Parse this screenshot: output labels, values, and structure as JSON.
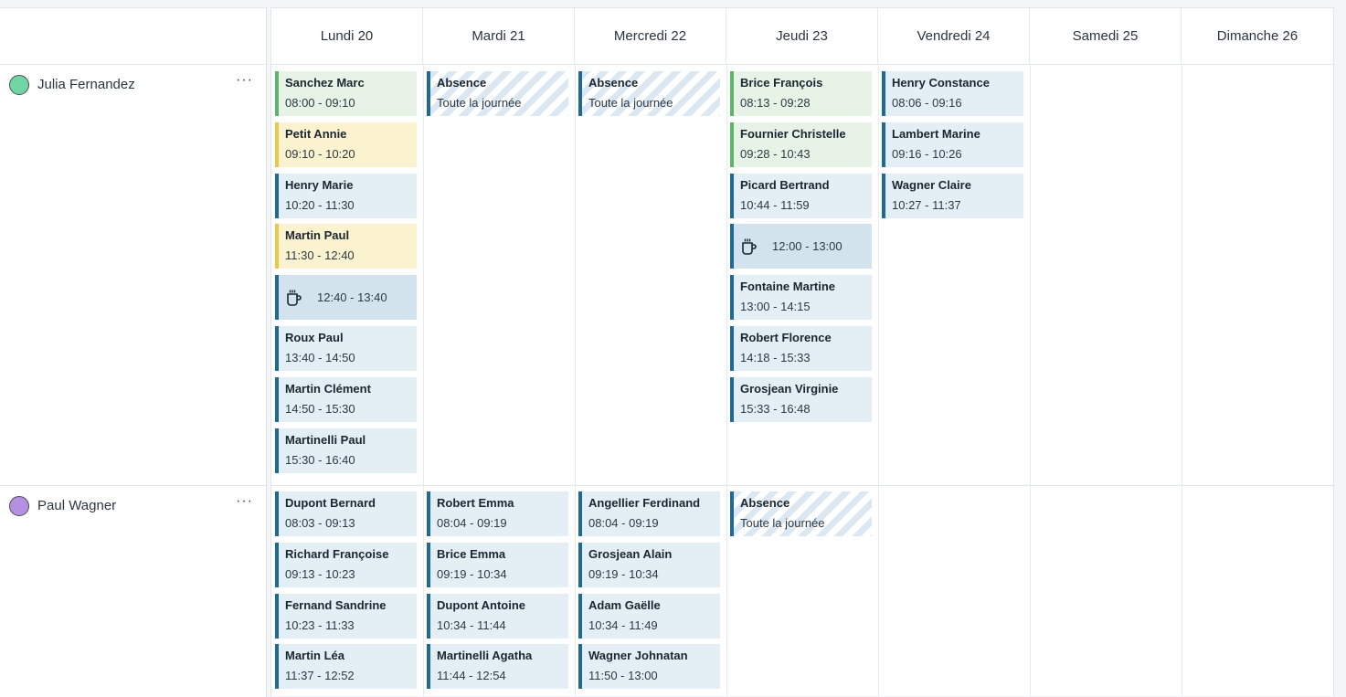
{
  "colors": {
    "julia_avatar": "#6fd6a4",
    "paul_avatar": "#b58fe0",
    "event_blue": "#e3eef5",
    "event_green": "#e6f3e6",
    "event_yellow": "#fbf2cf",
    "accent": "#1d6a96"
  },
  "days": [
    {
      "label": "Lundi 20"
    },
    {
      "label": "Mardi 21"
    },
    {
      "label": "Mercredi 22"
    },
    {
      "label": "Jeudi 23"
    },
    {
      "label": "Vendredi 24"
    },
    {
      "label": "Samedi 25"
    },
    {
      "label": "Dimanche 26"
    }
  ],
  "people": [
    {
      "name": "Julia Fernandez",
      "menu": "···"
    },
    {
      "name": "Paul Wagner",
      "menu": "···"
    }
  ],
  "events": [
    {
      "person": 0,
      "day": 0,
      "slot": 0,
      "kind": "green",
      "title": "Sanchez Marc",
      "time": "08:00 - 09:10"
    },
    {
      "person": 0,
      "day": 0,
      "slot": 1,
      "kind": "yellow",
      "title": "Petit Annie",
      "time": "09:10 - 10:20"
    },
    {
      "person": 0,
      "day": 0,
      "slot": 2,
      "kind": "blue",
      "title": "Henry Marie",
      "time": "10:20 - 11:30"
    },
    {
      "person": 0,
      "day": 0,
      "slot": 3,
      "kind": "yellow",
      "title": "Martin Paul",
      "time": "11:30 - 12:40"
    },
    {
      "person": 0,
      "day": 0,
      "slot": 4,
      "kind": "pause",
      "icon": "coffee-cup-icon",
      "time": "12:40 - 13:40"
    },
    {
      "person": 0,
      "day": 0,
      "slot": 5,
      "kind": "blue",
      "title": "Roux Paul",
      "time": "13:40 - 14:50"
    },
    {
      "person": 0,
      "day": 0,
      "slot": 6,
      "kind": "blue",
      "title": "Martin Clément",
      "time": "14:50 - 15:30"
    },
    {
      "person": 0,
      "day": 0,
      "slot": 7,
      "kind": "blue",
      "title": "Martinelli Paul",
      "time": "15:30 - 16:40"
    },
    {
      "person": 0,
      "day": 1,
      "slot": 0,
      "kind": "absence",
      "title": "Absence",
      "time": "Toute la journée"
    },
    {
      "person": 0,
      "day": 2,
      "slot": 0,
      "kind": "absence",
      "title": "Absence",
      "time": "Toute la journée"
    },
    {
      "person": 0,
      "day": 3,
      "slot": 0,
      "kind": "green",
      "title": "Brice François",
      "time": "08:13 - 09:28"
    },
    {
      "person": 0,
      "day": 3,
      "slot": 1,
      "kind": "green",
      "title": "Fournier Christelle",
      "time": "09:28 - 10:43"
    },
    {
      "person": 0,
      "day": 3,
      "slot": 2,
      "kind": "blue",
      "title": "Picard Bertrand",
      "time": "10:44 - 11:59"
    },
    {
      "person": 0,
      "day": 3,
      "slot": 3,
      "kind": "pause",
      "icon": "coffee-cup-icon",
      "time": "12:00 - 13:00"
    },
    {
      "person": 0,
      "day": 3,
      "slot": 4,
      "kind": "blue",
      "title": "Fontaine Martine",
      "time": "13:00 - 14:15"
    },
    {
      "person": 0,
      "day": 3,
      "slot": 5,
      "kind": "blue",
      "title": "Robert Florence",
      "time": "14:18 - 15:33"
    },
    {
      "person": 0,
      "day": 3,
      "slot": 6,
      "kind": "blue",
      "title": "Grosjean Virginie",
      "time": "15:33 - 16:48"
    },
    {
      "person": 0,
      "day": 4,
      "slot": 0,
      "kind": "blue",
      "title": "Henry Constance",
      "time": "08:06 - 09:16"
    },
    {
      "person": 0,
      "day": 4,
      "slot": 1,
      "kind": "blue",
      "title": "Lambert Marine",
      "time": "09:16 - 10:26"
    },
    {
      "person": 0,
      "day": 4,
      "slot": 2,
      "kind": "blue",
      "title": "Wagner Claire",
      "time": "10:27 - 11:37"
    },
    {
      "person": 1,
      "day": 0,
      "slot": 0,
      "kind": "blue",
      "title": "Dupont Bernard",
      "time": "08:03 - 09:13"
    },
    {
      "person": 1,
      "day": 0,
      "slot": 1,
      "kind": "blue",
      "title": "Richard Françoise",
      "time": "09:13 - 10:23"
    },
    {
      "person": 1,
      "day": 0,
      "slot": 2,
      "kind": "blue",
      "title": "Fernand Sandrine",
      "time": "10:23 - 11:33"
    },
    {
      "person": 1,
      "day": 0,
      "slot": 3,
      "kind": "blue",
      "title": "Martin Léa",
      "time": "11:37 - 12:52"
    },
    {
      "person": 1,
      "day": 1,
      "slot": 0,
      "kind": "blue",
      "title": "Robert Emma",
      "time": "08:04 - 09:19"
    },
    {
      "person": 1,
      "day": 1,
      "slot": 1,
      "kind": "blue",
      "title": "Brice Emma",
      "time": "09:19 - 10:34"
    },
    {
      "person": 1,
      "day": 1,
      "slot": 2,
      "kind": "blue",
      "title": "Dupont Antoine",
      "time": "10:34 - 11:44"
    },
    {
      "person": 1,
      "day": 1,
      "slot": 3,
      "kind": "blue",
      "title": "Martinelli Agatha",
      "time": "11:44 - 12:54"
    },
    {
      "person": 1,
      "day": 2,
      "slot": 0,
      "kind": "blue",
      "title": "Angellier Ferdinand",
      "time": "08:04 - 09:19"
    },
    {
      "person": 1,
      "day": 2,
      "slot": 1,
      "kind": "blue",
      "title": "Grosjean Alain",
      "time": "09:19 - 10:34"
    },
    {
      "person": 1,
      "day": 2,
      "slot": 2,
      "kind": "blue",
      "title": "Adam Gaëlle",
      "time": "10:34 - 11:49"
    },
    {
      "person": 1,
      "day": 2,
      "slot": 3,
      "kind": "blue",
      "title": "Wagner Johnatan",
      "time": "11:50 - 13:00"
    },
    {
      "person": 1,
      "day": 3,
      "slot": 0,
      "kind": "absence",
      "title": "Absence",
      "time": "Toute la journée"
    }
  ]
}
